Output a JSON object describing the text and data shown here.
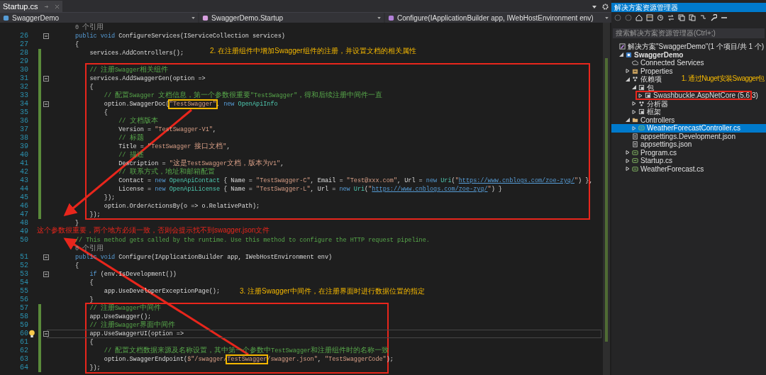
{
  "editor": {
    "tab": {
      "title": "Startup.cs",
      "selected": true
    },
    "nav": {
      "project": "SwaggerDemo",
      "class": "SwaggerDemo.Startup",
      "member": "Configure(IApplicationBuilder app, IWebHostEnvironment env)"
    },
    "lines": [
      {
        "kind": "codelens",
        "text": "0 个引用"
      },
      {
        "kind": "code",
        "number": "26",
        "changed": false,
        "collapsible": true,
        "current": false,
        "lightbulb": false,
        "tokens": [
          {
            "kind": "keyword",
            "text": "public void "
          },
          {
            "kind": "plain",
            "text": "ConfigureServices(IServiceCollection services)"
          }
        ]
      },
      {
        "kind": "code",
        "number": "27",
        "changed": false,
        "collapsible": false,
        "current": false,
        "lightbulb": false,
        "tokens": [
          {
            "kind": "plain",
            "text": "{"
          }
        ]
      },
      {
        "kind": "code",
        "number": "28",
        "changed": true,
        "collapsible": false,
        "current": false,
        "lightbulb": false,
        "tokens": [
          {
            "kind": "plain",
            "text": "    services.AddControllers();"
          }
        ]
      },
      {
        "kind": "code",
        "number": "29",
        "changed": true,
        "collapsible": false,
        "current": false,
        "lightbulb": false
      },
      {
        "kind": "code",
        "number": "30",
        "changed": true,
        "collapsible": false,
        "current": false,
        "lightbulb": false,
        "tokens": [
          {
            "kind": "comment",
            "text": "    // 注册Swagger相关组件"
          }
        ]
      },
      {
        "kind": "code",
        "number": "31",
        "changed": true,
        "collapsible": true,
        "current": false,
        "lightbulb": false,
        "tokens": [
          {
            "kind": "plain",
            "text": "    services.AddSwaggerGen(option =>"
          }
        ]
      },
      {
        "kind": "code",
        "number": "32",
        "changed": true,
        "collapsible": false,
        "current": false,
        "lightbulb": false,
        "tokens": [
          {
            "kind": "plain",
            "text": "    {"
          }
        ]
      },
      {
        "kind": "code",
        "number": "33",
        "changed": true,
        "collapsible": false,
        "current": false,
        "lightbulb": false,
        "tokens": [
          {
            "kind": "comment",
            "text": "        // 配置Swagger 文档信息，第一个参数很重要\"TestSwagger\"，得和后续注册中间件一直"
          }
        ]
      },
      {
        "kind": "code",
        "number": "34",
        "changed": true,
        "collapsible": true,
        "current": false,
        "lightbulb": false,
        "tokens": [
          {
            "kind": "plain",
            "text": "        option.SwaggerDoc("
          },
          {
            "kind": "string",
            "text": "\"TestSwagger\"",
            "boxed": true
          },
          {
            "kind": "plain",
            "text": ", "
          },
          {
            "kind": "keyword",
            "text": "new "
          },
          {
            "kind": "type",
            "text": "OpenApiInfo"
          }
        ]
      },
      {
        "kind": "code",
        "number": "35",
        "changed": true,
        "collapsible": false,
        "current": false,
        "lightbulb": false,
        "tokens": [
          {
            "kind": "plain",
            "text": "        {"
          }
        ]
      },
      {
        "kind": "code",
        "number": "36",
        "changed": true,
        "collapsible": false,
        "current": false,
        "lightbulb": false,
        "tokens": [
          {
            "kind": "comment",
            "text": "            // 文档版本"
          }
        ]
      },
      {
        "kind": "code",
        "number": "37",
        "changed": true,
        "collapsible": false,
        "current": false,
        "lightbulb": false,
        "tokens": [
          {
            "kind": "plain",
            "text": "            Version = "
          },
          {
            "kind": "string",
            "text": "\"TestSwagger-V1\""
          },
          {
            "kind": "plain",
            "text": ","
          }
        ]
      },
      {
        "kind": "code",
        "number": "38",
        "changed": true,
        "collapsible": false,
        "current": false,
        "lightbulb": false,
        "tokens": [
          {
            "kind": "comment",
            "text": "            // 标题"
          }
        ]
      },
      {
        "kind": "code",
        "number": "39",
        "changed": true,
        "collapsible": false,
        "current": false,
        "lightbulb": false,
        "tokens": [
          {
            "kind": "plain",
            "text": "            Title = "
          },
          {
            "kind": "string",
            "text": "\"TestSwagger 接口文档\""
          },
          {
            "kind": "plain",
            "text": ","
          }
        ]
      },
      {
        "kind": "code",
        "number": "40",
        "changed": true,
        "collapsible": false,
        "current": false,
        "lightbulb": false,
        "tokens": [
          {
            "kind": "comment",
            "text": "            // 描述"
          }
        ]
      },
      {
        "kind": "code",
        "number": "41",
        "changed": true,
        "collapsible": false,
        "current": false,
        "lightbulb": false,
        "tokens": [
          {
            "kind": "plain",
            "text": "            Description = "
          },
          {
            "kind": "string",
            "text": "\"这是TestSwagger文档，版本为V1\""
          },
          {
            "kind": "plain",
            "text": ","
          }
        ]
      },
      {
        "kind": "code",
        "number": "42",
        "changed": true,
        "collapsible": false,
        "current": false,
        "lightbulb": false,
        "tokens": [
          {
            "kind": "comment",
            "text": "            // 联系方式，地址和邮箱配置"
          }
        ]
      },
      {
        "kind": "code",
        "number": "43",
        "changed": true,
        "collapsible": false,
        "current": false,
        "lightbulb": false,
        "tokens": [
          {
            "kind": "plain",
            "text": "            Contact = "
          },
          {
            "kind": "keyword",
            "text": "new "
          },
          {
            "kind": "type",
            "text": "OpenApiContact"
          },
          {
            "kind": "plain",
            "text": " { Name = "
          },
          {
            "kind": "string",
            "text": "\"TestSwagger-C\""
          },
          {
            "kind": "plain",
            "text": ", Email = "
          },
          {
            "kind": "string",
            "text": "\"Test@xxx.com\""
          },
          {
            "kind": "plain",
            "text": ", Url = "
          },
          {
            "kind": "keyword",
            "text": "new "
          },
          {
            "kind": "type",
            "text": "Uri"
          },
          {
            "kind": "plain",
            "text": "("
          },
          {
            "kind": "string",
            "text": "\""
          },
          {
            "kind": "url",
            "text": "https://www.cnblogs.com/zoe-zyq/"
          },
          {
            "kind": "string",
            "text": "\""
          },
          {
            "kind": "plain",
            "text": ") },"
          }
        ]
      },
      {
        "kind": "code",
        "number": "44",
        "changed": true,
        "collapsible": false,
        "current": false,
        "lightbulb": false,
        "tokens": [
          {
            "kind": "plain",
            "text": "            License = "
          },
          {
            "kind": "keyword",
            "text": "new "
          },
          {
            "kind": "type",
            "text": "OpenApiLicense"
          },
          {
            "kind": "plain",
            "text": " { Name = "
          },
          {
            "kind": "string",
            "text": "\"TestSwagger-L\""
          },
          {
            "kind": "plain",
            "text": ", Url = "
          },
          {
            "kind": "keyword",
            "text": "new "
          },
          {
            "kind": "type",
            "text": "Uri"
          },
          {
            "kind": "plain",
            "text": "("
          },
          {
            "kind": "string",
            "text": "\""
          },
          {
            "kind": "url",
            "text": "https://www.cnblogs.com/zoe-zyq/"
          },
          {
            "kind": "string",
            "text": "\""
          },
          {
            "kind": "plain",
            "text": ") }"
          }
        ]
      },
      {
        "kind": "code",
        "number": "45",
        "changed": true,
        "collapsible": false,
        "current": false,
        "lightbulb": false,
        "tokens": [
          {
            "kind": "plain",
            "text": "        });"
          }
        ]
      },
      {
        "kind": "code",
        "number": "46",
        "changed": true,
        "collapsible": false,
        "current": false,
        "lightbulb": false,
        "tokens": [
          {
            "kind": "plain",
            "text": "        option.OrderActionsBy(o => o.RelativePath);"
          }
        ]
      },
      {
        "kind": "code",
        "number": "47",
        "changed": true,
        "collapsible": false,
        "current": false,
        "lightbulb": false,
        "tokens": [
          {
            "kind": "plain",
            "text": "    });"
          }
        ]
      },
      {
        "kind": "code",
        "number": "48",
        "changed": false,
        "collapsible": false,
        "current": false,
        "lightbulb": false,
        "tokens": [
          {
            "kind": "plain",
            "text": "}"
          }
        ]
      },
      {
        "kind": "code",
        "number": "49",
        "changed": false,
        "collapsible": false,
        "current": false,
        "lightbulb": false
      },
      {
        "kind": "code",
        "number": "50",
        "changed": false,
        "collapsible": false,
        "current": false,
        "lightbulb": false,
        "tokens": [
          {
            "kind": "comment",
            "text": "// This method gets called by the runtime. Use this method to configure the HTTP request pipeline."
          }
        ]
      },
      {
        "kind": "codelens",
        "text": "0 个引用"
      },
      {
        "kind": "code",
        "number": "51",
        "changed": false,
        "collapsible": true,
        "current": false,
        "lightbulb": false,
        "tokens": [
          {
            "kind": "keyword",
            "text": "public void "
          },
          {
            "kind": "plain",
            "text": "Configure(IApplicationBuilder app, IWebHostEnvironment env)"
          }
        ]
      },
      {
        "kind": "code",
        "number": "52",
        "changed": false,
        "collapsible": false,
        "current": false,
        "lightbulb": false,
        "tokens": [
          {
            "kind": "plain",
            "text": "{"
          }
        ]
      },
      {
        "kind": "code",
        "number": "53",
        "changed": false,
        "collapsible": true,
        "current": false,
        "lightbulb": false,
        "tokens": [
          {
            "kind": "keyword",
            "text": "    if "
          },
          {
            "kind": "plain",
            "text": "(env.IsDevelopment())"
          }
        ]
      },
      {
        "kind": "code",
        "number": "54",
        "changed": false,
        "collapsible": false,
        "current": false,
        "lightbulb": false,
        "tokens": [
          {
            "kind": "plain",
            "text": "    {"
          }
        ]
      },
      {
        "kind": "code",
        "number": "55",
        "changed": false,
        "collapsible": false,
        "current": false,
        "lightbulb": false,
        "tokens": [
          {
            "kind": "plain",
            "text": "        app.UseDeveloperExceptionPage();"
          }
        ]
      },
      {
        "kind": "code",
        "number": "56",
        "changed": false,
        "collapsible": false,
        "current": false,
        "lightbulb": false,
        "tokens": [
          {
            "kind": "plain",
            "text": "    }"
          }
        ]
      },
      {
        "kind": "code",
        "number": "57",
        "changed": true,
        "collapsible": false,
        "current": false,
        "lightbulb": false,
        "tokens": [
          {
            "kind": "comment",
            "text": "    // 注册Swagger中间件"
          }
        ]
      },
      {
        "kind": "code",
        "number": "58",
        "changed": true,
        "collapsible": false,
        "current": false,
        "lightbulb": false,
        "tokens": [
          {
            "kind": "plain",
            "text": "    app.UseSwagger();"
          }
        ]
      },
      {
        "kind": "code",
        "number": "59",
        "changed": true,
        "collapsible": false,
        "current": false,
        "lightbulb": false,
        "tokens": [
          {
            "kind": "comment",
            "text": "    // 注册Swagger界面中间件"
          }
        ]
      },
      {
        "kind": "code",
        "number": "60",
        "changed": true,
        "collapsible": true,
        "current": true,
        "lightbulb": true,
        "tokens": [
          {
            "kind": "plain",
            "text": "    app.UseSwaggerUI(option =>"
          }
        ]
      },
      {
        "kind": "code",
        "number": "61",
        "changed": true,
        "collapsible": false,
        "current": false,
        "lightbulb": false,
        "tokens": [
          {
            "kind": "plain",
            "text": "    {"
          }
        ]
      },
      {
        "kind": "code",
        "number": "62",
        "changed": true,
        "collapsible": false,
        "current": false,
        "lightbulb": false,
        "tokens": [
          {
            "kind": "comment",
            "text": "        // 配置文档数据来源及名称设置，其中第一个参数中TestSwagger和注册组件时的名称一致"
          }
        ]
      },
      {
        "kind": "code",
        "number": "63",
        "changed": true,
        "collapsible": false,
        "current": false,
        "lightbulb": false,
        "tokens": [
          {
            "kind": "plain",
            "text": "        option.SwaggerEndpoint("
          },
          {
            "kind": "string",
            "text": "$\"/swagger/"
          },
          {
            "kind": "string",
            "text": "TestSwagger",
            "boxed": true
          },
          {
            "kind": "string",
            "text": "/swagger.json\""
          },
          {
            "kind": "plain",
            "text": ", "
          },
          {
            "kind": "string",
            "text": "\"TestSwaggerCode\""
          },
          {
            "kind": "plain",
            "text": ");"
          }
        ]
      },
      {
        "kind": "code",
        "number": "64",
        "changed": true,
        "collapsible": false,
        "current": false,
        "lightbulb": false,
        "tokens": [
          {
            "kind": "plain",
            "text": "    });"
          }
        ]
      }
    ]
  },
  "solution_explorer": {
    "title": "解决方案资源管理器",
    "search": {
      "placeholder": "搜索解决方案资源管理器(Ctrl+;)"
    },
    "tree": [
      {
        "label": "解决方案\"SwaggerDemo\"(1 个项目/共 1 个)",
        "kind": "solution",
        "selected": false,
        "children": [
          {
            "label": "SwaggerDemo",
            "kind": "project",
            "selected": false,
            "expanded": true,
            "children": [
              {
                "label": "Connected Services",
                "kind": "service",
                "selected": false
              },
              {
                "label": "Properties",
                "kind": "properties",
                "selected": false,
                "expanded": false
              },
              {
                "label": "依赖项",
                "kind": "deps",
                "selected": false,
                "expanded": true,
                "children": [
                  {
                    "label": "包",
                    "kind": "package",
                    "selected": false,
                    "expanded": true,
                    "children": [
                      {
                        "label": "Swashbuckle.AspNetCore (5.6.3)",
                        "kind": "package",
                        "selected": false,
                        "expanded": false
                      }
                    ]
                  },
                  {
                    "label": "分析器",
                    "kind": "deps",
                    "selected": false,
                    "expanded": false
                  },
                  {
                    "label": "框架",
                    "kind": "package",
                    "selected": false,
                    "expanded": false
                  }
                ]
              },
              {
                "label": "Controllers",
                "kind": "folder",
                "selected": false,
                "expanded": true,
                "children": [
                  {
                    "label": "WeatherForecastController.cs",
                    "kind": "csharp",
                    "selected": true,
                    "expanded": false
                  }
                ]
              },
              {
                "label": "appsettings.Development.json",
                "kind": "json",
                "selected": false
              },
              {
                "label": "appsettings.json",
                "kind": "json",
                "selected": false
              },
              {
                "label": "Program.cs",
                "kind": "csharp",
                "selected": false,
                "expanded": false
              },
              {
                "label": "Startup.cs",
                "kind": "csharp",
                "selected": false,
                "expanded": false
              },
              {
                "label": "WeatherForecast.cs",
                "kind": "csharp",
                "selected": false,
                "expanded": false
              }
            ]
          }
        ]
      }
    ]
  },
  "annotations": [
    {
      "kind": "note",
      "text": "2. 在注册组件中增加Swagger组件的注册，并设置文档的相关属性"
    },
    {
      "kind": "warning",
      "text": "这个参数很重要，两个地方必须一致，否则会提示找不到swagger.json文件"
    },
    {
      "kind": "note",
      "text": "3. 注册Swagger中间件，在注册界面时进行数据位置的指定"
    },
    {
      "kind": "note",
      "text": "1. 通过Nuget安装Swagger包"
    }
  ]
}
